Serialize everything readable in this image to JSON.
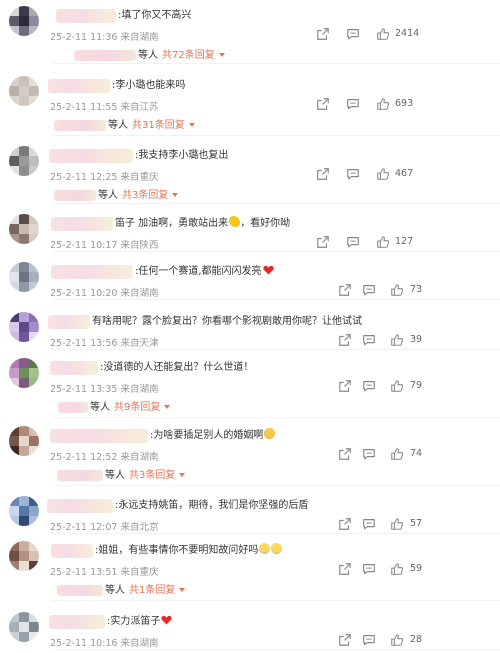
{
  "comments": [
    {
      "text": ":填了你又不高兴",
      "time": "25-2-11 11:36",
      "location": "来自湖南",
      "likes": "2414",
      "reply_who": "等人",
      "reply_link": "共72条回复",
      "avatar_colors": [
        "#d9d9d9",
        "#3b3b4d",
        "#aaaaaa",
        "#5c5c70",
        "#2d2d3a",
        "#8a8aa0",
        "#c4c4cc",
        "#6d6d80",
        "#b8b8c4"
      ]
    },
    {
      "text": ":李小璐也能来吗",
      "time": "25-2-11 11:55",
      "location": "来自江苏",
      "likes": "693",
      "reply_who": "等人",
      "reply_link": "共31条回复",
      "avatar_colors": [
        "#d7d0c9",
        "#c9c1b6",
        "#e4ddd5",
        "#b8b0a6",
        "#d5cdc4",
        "#c3bbb1",
        "#ddd5cc",
        "#cfc7be",
        "#e2dbd3"
      ]
    },
    {
      "text": ":我支持李小璐也复出",
      "time": "25-2-11 12:25",
      "location": "来自重庆",
      "likes": "467",
      "reply_who": "等人",
      "reply_link": "共3条回复",
      "avatar_colors": [
        "#cfcfcf",
        "#7a7a7a",
        "#d8d8d8",
        "#5e5e5e",
        "#9a9a9a",
        "#bdbdbd",
        "#e2e2e2",
        "#8e8e8e",
        "#c9c9c9"
      ]
    },
    {
      "text": "笛子 加油啊，勇敢站出来",
      "text_after": "，看好你呦",
      "time": "25-2-11 10:17",
      "location": "来自陕西",
      "likes": "127",
      "avatar_colors": [
        "#e3e3e3",
        "#5b4d47",
        "#d2c6c0",
        "#7a6760",
        "#c7b8b0",
        "#e0d6cf",
        "#a89890",
        "#8c7a72",
        "#d8ccc4"
      ]
    },
    {
      "text": ":任何一个赛道,都能闪闪发亮",
      "time": "25-2-11 10:20",
      "location": "来自湖南",
      "likes": "73",
      "avatar_colors": [
        "#c7ccd3",
        "#7d8794",
        "#b9c2cc",
        "#e1e5ea",
        "#6b7582",
        "#a7b1bd",
        "#d4d9df",
        "#8f99a5",
        "#c0c8d1"
      ]
    },
    {
      "text": "有啥用呢？露个脸复出？你看哪个影视剧敢用你呢？让他试试",
      "time": "25-2-11 13:56",
      "location": "来自天津",
      "likes": "39",
      "avatar_colors": [
        "#4a3f6b",
        "#b6a3d6",
        "#8a6fb8",
        "#d8c8ee",
        "#5e4a8a",
        "#a58bd0",
        "#c9b7e4",
        "#6f579c",
        "#e4d9f3"
      ]
    },
    {
      "text": ":没道德的人还能复出？什么世道！",
      "time": "25-2-11 13:35",
      "location": "来自湖南",
      "likes": "79",
      "reply_who": "等人",
      "reply_link": "共9条回复",
      "avatar_colors": [
        "#b07bb0",
        "#8a5c8a",
        "#5e7a4a",
        "#c99ac9",
        "#6b8f55",
        "#a0c48a",
        "#e2c6e2",
        "#7b5a7b",
        "#9ab885"
      ]
    },
    {
      "text": ":为啥要插足别人的婚姻啊",
      "time": "25-2-11 12:52",
      "location": "来自湖南",
      "likes": "74",
      "reply_who": "等人",
      "reply_link": "共3条回复",
      "avatar_colors": [
        "#5c3f34",
        "#b08a78",
        "#d6bfb2",
        "#7a5648",
        "#e6d6cc",
        "#9a7262",
        "#3f2b24",
        "#c4a696",
        "#e9ddd6"
      ]
    },
    {
      "text": ":永远支持姚笛，期待，我们是你坚强的后盾",
      "time": "25-2-11 12:07",
      "location": "来自北京",
      "likes": "57",
      "avatar_colors": [
        "#6a86b0",
        "#9bb4d6",
        "#3f5c8a",
        "#c9d8ec",
        "#5478a8",
        "#8aa6cc",
        "#b4c8e2",
        "#2f4a73",
        "#a8bedb"
      ]
    },
    {
      "text": ":姐姐，有些事情你不要明知故问好吗",
      "time": "25-2-11 13:51",
      "location": "来自重庆",
      "likes": "59",
      "reply_who": "等人",
      "reply_link": "共1条回复",
      "avatar_colors": [
        "#8c6a5e",
        "#c9ad9f",
        "#e6d7cf",
        "#6e5046",
        "#b3917f",
        "#d8c2b6",
        "#a07f70",
        "#e9ded8",
        "#5a4038"
      ]
    },
    {
      "text": ":实力派笛子",
      "time": "25-2-11 10:16",
      "location": "来自湖南",
      "likes": "28",
      "avatar_colors": [
        "#bfc6cc",
        "#8d969e",
        "#d7dce0",
        "#a9b1b8",
        "#e1e4e7",
        "#7d868e",
        "#c8ced3",
        "#9aa2a9",
        "#e8eaec"
      ]
    }
  ],
  "icons": {
    "share": "share-icon",
    "comment": "comment-icon",
    "like": "thumbs-up-icon",
    "emoji_muscle": "flexed-biceps-emoji",
    "emoji_heart": "red-heart-emoji",
    "emoji_angry": "angry-face-emoji",
    "emoji_cry": "crying-face-emoji"
  },
  "colors": {
    "link": "#eb7350",
    "meta": "#999999",
    "text": "#333333"
  }
}
